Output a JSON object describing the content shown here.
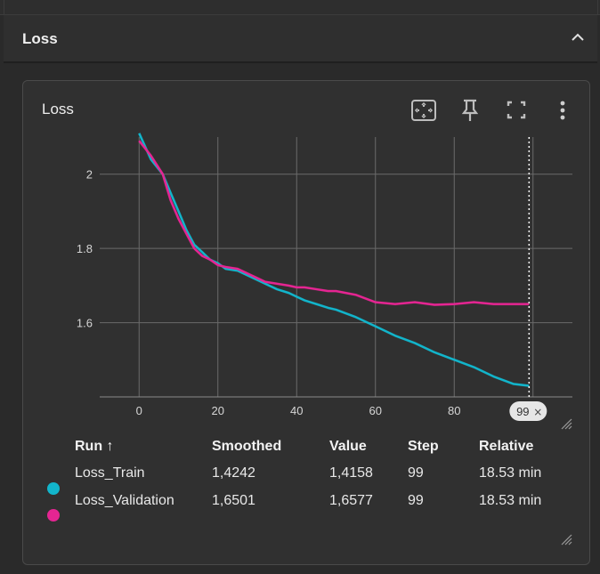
{
  "section": {
    "title": "Loss"
  },
  "card": {
    "title": "Loss"
  },
  "toolbar": {
    "fit_icon": "fit-domain-icon",
    "pin_icon": "pin-icon",
    "fullscreen_icon": "fullscreen-icon",
    "more_icon": "more-vert-icon"
  },
  "chart_data": {
    "type": "line",
    "title": "",
    "xlabel": "",
    "ylabel": "",
    "xlim": [
      -10,
      110
    ],
    "ylim": [
      1.4,
      2.1
    ],
    "x_ticks": [
      "0",
      "20",
      "40",
      "60",
      "80"
    ],
    "y_ticks": [
      "1.6",
      "1.8",
      "2"
    ],
    "grid": true,
    "hover_step_label": "99",
    "series": [
      {
        "name": "Loss_Train",
        "color": "#12b5cb",
        "x": [
          0,
          3,
          6,
          8,
          10,
          12,
          14,
          16,
          18,
          20,
          22,
          25,
          28,
          30,
          32,
          35,
          38,
          40,
          42,
          45,
          48,
          50,
          55,
          60,
          65,
          70,
          75,
          80,
          85,
          90,
          95,
          99
        ],
        "y": [
          2.11,
          2.04,
          2.0,
          1.95,
          1.9,
          1.85,
          1.81,
          1.79,
          1.77,
          1.76,
          1.745,
          1.74,
          1.725,
          1.715,
          1.705,
          1.69,
          1.68,
          1.67,
          1.66,
          1.65,
          1.64,
          1.635,
          1.615,
          1.59,
          1.565,
          1.545,
          1.52,
          1.5,
          1.48,
          1.455,
          1.435,
          1.43
        ]
      },
      {
        "name": "Loss_Validation",
        "color": "#e52592",
        "x": [
          0,
          3,
          6,
          8,
          10,
          12,
          14,
          16,
          18,
          20,
          22,
          25,
          28,
          30,
          32,
          35,
          38,
          40,
          42,
          45,
          48,
          50,
          55,
          60,
          65,
          70,
          75,
          80,
          85,
          90,
          95,
          99
        ],
        "y": [
          2.09,
          2.05,
          2.0,
          1.93,
          1.88,
          1.84,
          1.8,
          1.78,
          1.77,
          1.755,
          1.75,
          1.745,
          1.73,
          1.72,
          1.71,
          1.705,
          1.7,
          1.695,
          1.695,
          1.69,
          1.685,
          1.685,
          1.675,
          1.655,
          1.65,
          1.655,
          1.648,
          1.65,
          1.655,
          1.65,
          1.65,
          1.65
        ]
      }
    ]
  },
  "legend": {
    "headers": {
      "run": "Run ↑",
      "smoothed": "Smoothed",
      "value": "Value",
      "step": "Step",
      "relative": "Relative"
    },
    "rows": [
      {
        "name": "Loss_Train",
        "color": "#12b5cb",
        "smoothed": "1,4242",
        "value": "1,4158",
        "step": "99",
        "relative": "18.53 min"
      },
      {
        "name": "Loss_Validation",
        "color": "#e52592",
        "smoothed": "1,6501",
        "value": "1,6577",
        "step": "99",
        "relative": "18.53 min"
      }
    ]
  }
}
